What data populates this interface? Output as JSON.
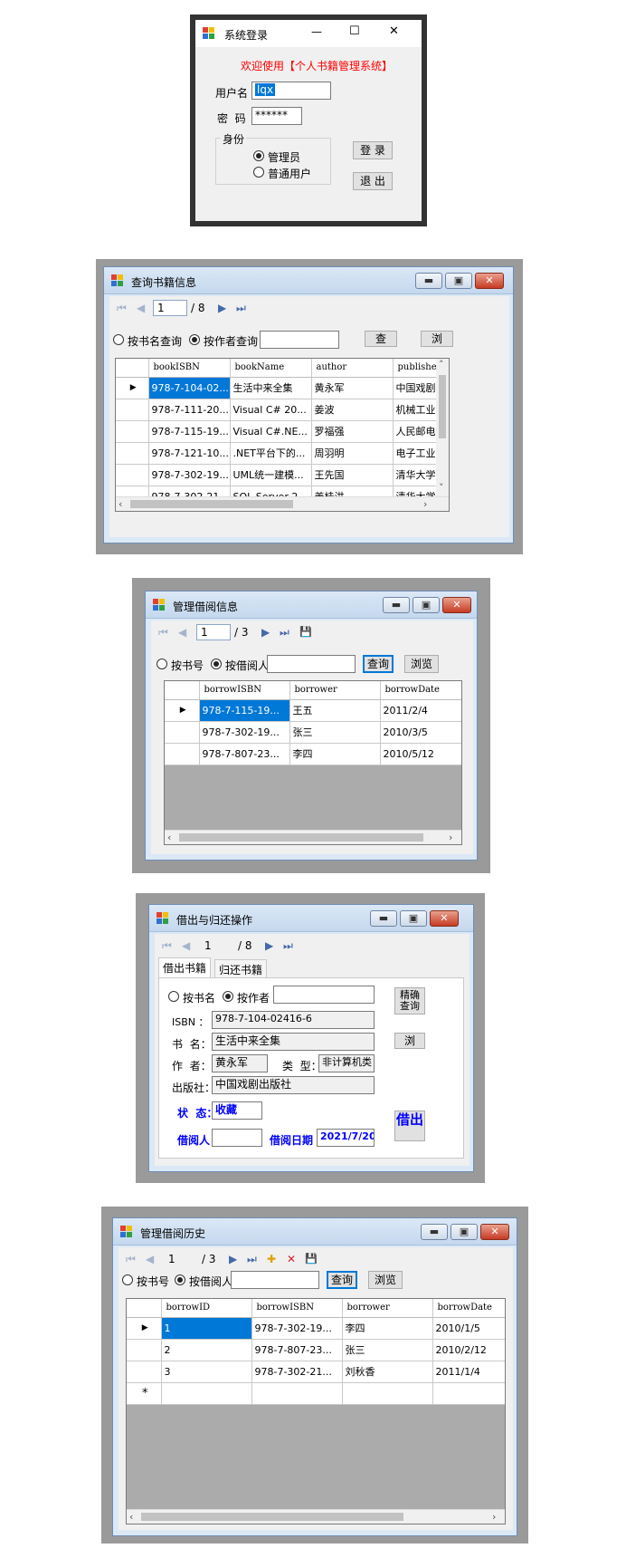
{
  "login": {
    "title": "系统登录",
    "welcome": "欢迎使用【个人书籍管理系统】",
    "username_label": "用户名",
    "username_value": "lqx",
    "password_label": "密  码",
    "password_value": "******",
    "role_group": "身份",
    "role_admin": "管理员",
    "role_user": "普通用户",
    "login_button": "登 录",
    "exit_button": "退 出",
    "minimize": "—",
    "maximize": "☐",
    "close": "✕"
  },
  "query_books": {
    "title": "查询书籍信息",
    "nav": {
      "page": "1",
      "total": "/ 8"
    },
    "radio_by_name": "按书名查询",
    "radio_by_author": "按作者查询",
    "search_value": "",
    "query_button": "查",
    "browse_button": "浏",
    "columns": [
      "bookISBN",
      "bookName",
      "author",
      "publishe"
    ],
    "rows": [
      [
        "978-7-104-02...",
        "生活中来全集",
        "黄永军",
        "中国戏剧"
      ],
      [
        "978-7-111-20...",
        "Visual C# 20...",
        "姜波",
        "机械工业"
      ],
      [
        "978-7-115-19...",
        "Visual C#.NE...",
        "罗福强",
        "人民邮电"
      ],
      [
        "978-7-121-10...",
        ".NET平台下的...",
        "周羽明",
        "电子工业"
      ],
      [
        "978-7-302-19...",
        "UML统一建模...",
        "王先国",
        "清华大学"
      ],
      [
        "978-7-302-21...",
        "SQL Server 2...",
        "姜桂洪",
        "清华大学"
      ]
    ]
  },
  "manage_borrow": {
    "title": "管理借阅信息",
    "nav": {
      "page": "1",
      "total": "/ 3"
    },
    "radio_by_isbn": "按书号",
    "radio_by_borrower": "按借阅人",
    "search_value": "",
    "query_button": "查询",
    "browse_button": "浏览",
    "columns": [
      "borrowISBN",
      "borrower",
      "borrowDate"
    ],
    "rows": [
      [
        "978-7-115-19...",
        "王五",
        "2011/2/4"
      ],
      [
        "978-7-302-19...",
        "张三",
        "2010/3/5"
      ],
      [
        "978-7-807-23...",
        "李四",
        "2010/5/12"
      ]
    ]
  },
  "borrow_return": {
    "title": "借出与归还操作",
    "nav": {
      "page": "1",
      "total": "/ 8"
    },
    "tab_borrow": "借出书籍",
    "tab_return": "归还书籍",
    "radio_by_name": "按书名",
    "radio_by_author": "按作者",
    "search_value": "",
    "exact_query_button": "精确查询",
    "browse_button": "浏",
    "isbn_label": "ISBN ：",
    "isbn_value": "978-7-104-02416-6",
    "title_label": "书  名：",
    "title_value": "生活中来全集",
    "author_label": "作  者：",
    "author_value": "黄永军",
    "type_label": "类  型：",
    "type_value": "非计算机类",
    "publisher_label": "出版社：",
    "publisher_value": "中国戏剧出版社",
    "status_label": "状  态：",
    "status_value": "收藏",
    "borrower_label": "借阅人",
    "borrower_value": "",
    "date_label": "借阅日期",
    "date_value": "2021/7/20",
    "borrow_button": "借出"
  },
  "borrow_history": {
    "title": "管理借阅历史",
    "nav": {
      "page": "1",
      "total": "/ 3"
    },
    "radio_by_isbn": "按书号",
    "radio_by_borrower": "按借阅人",
    "search_value": "",
    "query_button": "查询",
    "browse_button": "浏览",
    "columns": [
      "borrowID",
      "borrowISBN",
      "borrower",
      "borrowDate"
    ],
    "rows": [
      [
        "1",
        "978-7-302-19...",
        "李四",
        "2010/1/5"
      ],
      [
        "2",
        "978-7-807-23...",
        "张三",
        "2010/2/12"
      ],
      [
        "3",
        "978-7-302-21...",
        "刘秋香",
        "2011/1/4"
      ]
    ],
    "new_row_marker": "*"
  },
  "icons": {
    "first": "⏮",
    "prev": "◀",
    "next": "▶",
    "last": "⏭",
    "row_pointer": "▶",
    "add": "✚",
    "delete": "✕",
    "save": "💾"
  },
  "colors": {
    "welcome_red": "#ff0000",
    "selection_blue": "#0078d7",
    "label_blue": "#0000ff",
    "frame_gray": "#9a9a9a"
  }
}
